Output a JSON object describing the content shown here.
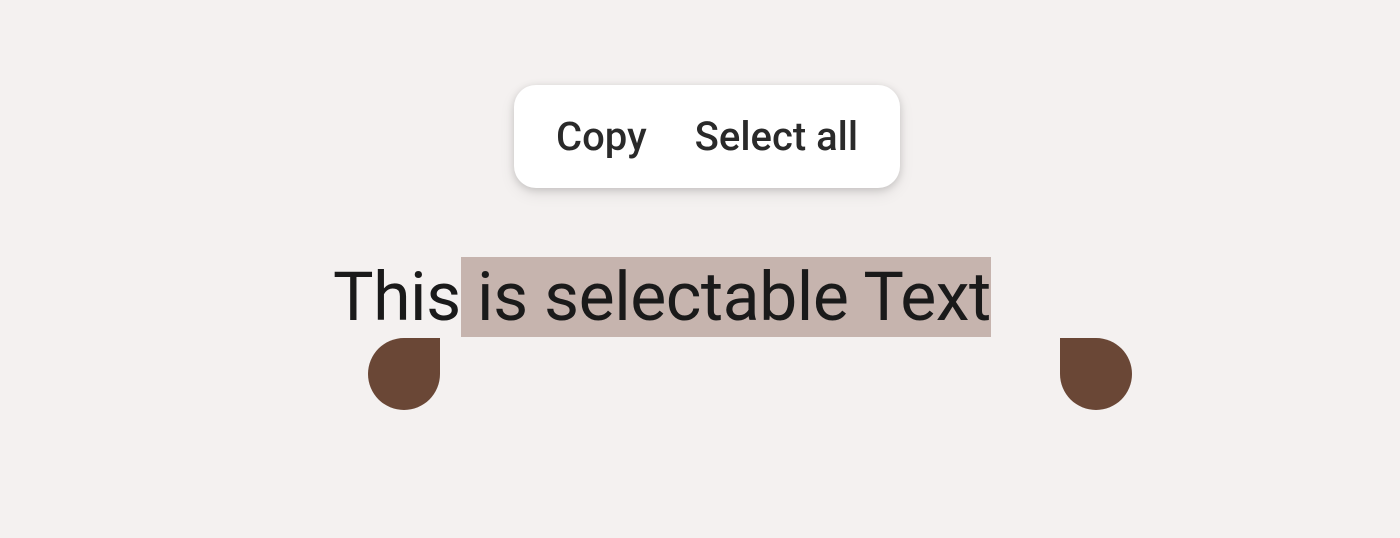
{
  "contextMenu": {
    "copy": "Copy",
    "selectAll": "Select all"
  },
  "text": {
    "before": "This",
    "selected": " is selectable Text"
  },
  "colors": {
    "background": "#f4f1f0",
    "selectionHighlight": "#c6b4ae",
    "handleColor": "#6a4736",
    "menuBackground": "#ffffff",
    "textColor": "#1a1a1a"
  }
}
